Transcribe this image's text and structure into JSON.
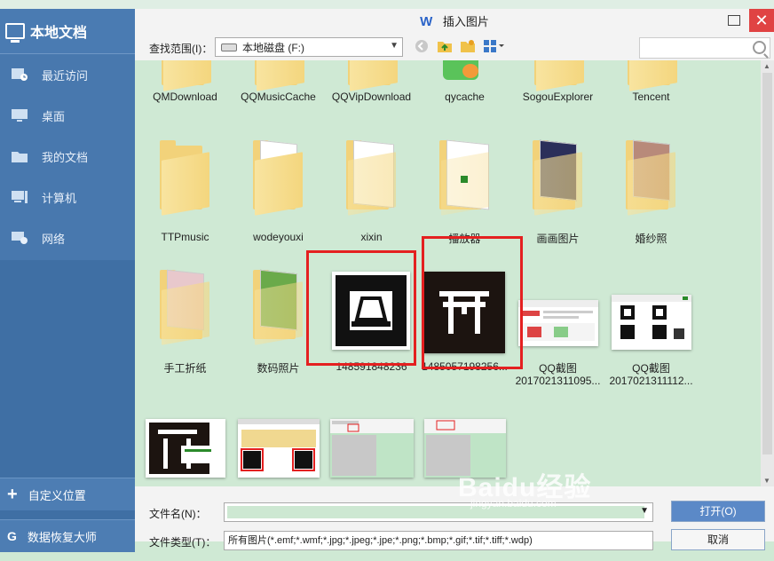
{
  "sidebar": {
    "header": "本地文档",
    "items": [
      {
        "label": "最近访问",
        "icon": "recent-icon"
      },
      {
        "label": "桌面",
        "icon": "desktop-icon"
      },
      {
        "label": "我的文档",
        "icon": "folder-icon"
      },
      {
        "label": "计算机",
        "icon": "computer-icon"
      },
      {
        "label": "网络",
        "icon": "network-icon"
      }
    ],
    "custom_location": "自定义位置",
    "recovery": "数据恢复大师"
  },
  "dialog": {
    "title": "插入图片",
    "look_in_label": "查找范围(I)：",
    "look_in_value": "本地磁盘 (F:)",
    "files": [
      {
        "label": "QMDownload",
        "kind": "folder-top"
      },
      {
        "label": "QQMusicCache",
        "kind": "folder-top"
      },
      {
        "label": "QQVipDownload",
        "kind": "folder-top"
      },
      {
        "label": "qycache",
        "kind": "folder-top"
      },
      {
        "label": "SogouExplorer",
        "kind": "folder-top"
      },
      {
        "label": "Tencent",
        "kind": "folder-top"
      },
      {
        "label": "TTPmusic",
        "kind": "folder"
      },
      {
        "label": "wodeyouxi",
        "kind": "folder"
      },
      {
        "label": "xixin",
        "kind": "folder"
      },
      {
        "label": "播放器",
        "kind": "folder"
      },
      {
        "label": "画画图片",
        "kind": "folder"
      },
      {
        "label": "婚纱照",
        "kind": "folder"
      },
      {
        "label": "手工折纸",
        "kind": "folder"
      },
      {
        "label": "数码照片",
        "kind": "folder"
      },
      {
        "label": "148591848236",
        "kind": "image"
      },
      {
        "label": "1485057198256...",
        "kind": "image"
      },
      {
        "label": "QQ截图",
        "label2": "2017021311095...",
        "kind": "image"
      },
      {
        "label": "QQ截图",
        "label2": "2017021311112...",
        "kind": "image"
      }
    ],
    "file_name_label": "文件名(N)：",
    "file_type_label": "文件类型(T)：",
    "file_type_value": "所有图片(*.emf;*.wmf;*.jpg;*.jpeg;*.jpe;*.png;*.bmp;*.gif;*.tif;*.tiff;*.wdp)",
    "open_button": "打开(O)",
    "cancel_button": "取消"
  },
  "watermark": {
    "text": "Baidu经验",
    "sub": "jingyan.baidu.com"
  },
  "colors": {
    "sidebar": "#3f6fa4",
    "filearea": "#cfe9d4",
    "highlight": "#e42020"
  }
}
